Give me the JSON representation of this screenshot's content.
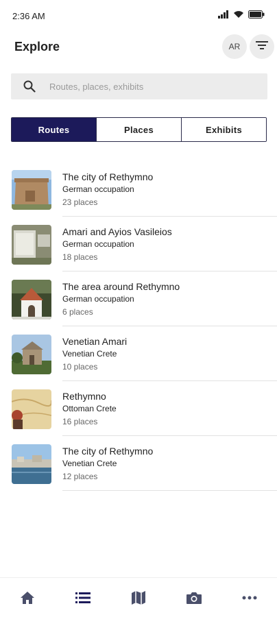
{
  "status_bar": {
    "time": "2:36 AM"
  },
  "header": {
    "title": "Explore",
    "avatar_initials": "AR"
  },
  "search": {
    "placeholder": "Routes, places, exhibits",
    "value": ""
  },
  "tabs": [
    {
      "label": "Routes",
      "active": true
    },
    {
      "label": "Places",
      "active": false
    },
    {
      "label": "Exhibits",
      "active": false
    }
  ],
  "routes": [
    {
      "title": "The city of Rethymno",
      "period": "German occupation",
      "count": "23 places"
    },
    {
      "title": "Amari and Ayios Vasileios",
      "period": "German occupation",
      "count": "18 places"
    },
    {
      "title": "The area around Rethymno",
      "period": "German occupation",
      "count": "6 places"
    },
    {
      "title": "Venetian Amari",
      "period": "Venetian Crete",
      "count": "10 places"
    },
    {
      "title": "Rethymno",
      "period": "Ottoman Crete",
      "count": "16 places"
    },
    {
      "title": "The city of Rethymno",
      "period": "Venetian Crete",
      "count": "12 places"
    }
  ],
  "bottom_nav": {
    "items": [
      {
        "icon": "home-icon",
        "active": false
      },
      {
        "icon": "list-icon",
        "active": true
      },
      {
        "icon": "map-icon",
        "active": false
      },
      {
        "icon": "camera-icon",
        "active": false
      },
      {
        "icon": "more-icon",
        "active": false
      }
    ]
  },
  "colors": {
    "accent": "#1c1a5a",
    "nav_icon": "#4a4f6a",
    "search_bg": "#ececec"
  }
}
